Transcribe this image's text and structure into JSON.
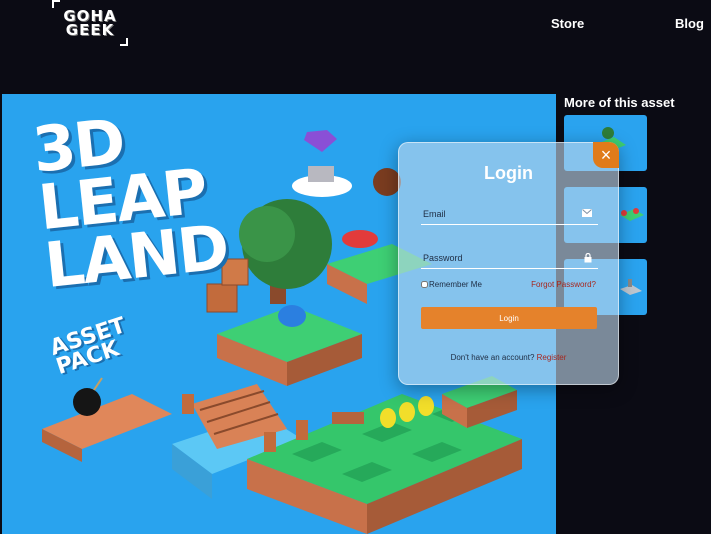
{
  "header": {
    "logo_line1": "GOHA",
    "logo_line2": "GEEK",
    "nav": {
      "store": "Store",
      "blog": "Blog"
    }
  },
  "hero": {
    "title_lines": [
      "3D",
      "LEAP",
      "LAND"
    ],
    "subtitle_lines": [
      "ASSET",
      "PACK"
    ]
  },
  "sidebar": {
    "title": "More of this asset"
  },
  "login": {
    "title": "Login",
    "close_label": "×",
    "email_placeholder": "Email",
    "password_placeholder": "Password",
    "remember_label": "Remember Me",
    "forgot_label": "Forgot Password?",
    "button_label": "Login",
    "no_account_text": "Don't have an account?",
    "register_label": "Register",
    "email_icon": "envelope-icon",
    "password_icon": "lock-icon"
  },
  "colors": {
    "background": "#0b0b14",
    "hero_blue": "#29a3ee",
    "accent_orange": "#e5822b",
    "link_red": "#a6271f"
  }
}
